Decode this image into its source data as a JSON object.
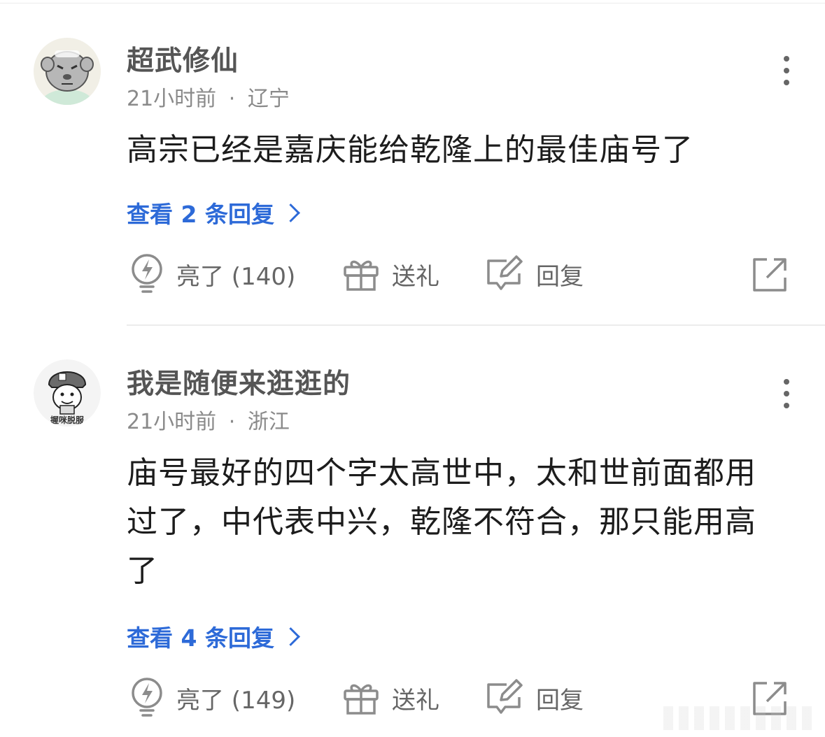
{
  "comments": [
    {
      "username": "超武修仙",
      "time": "21小时前",
      "location": "辽宁",
      "content": "高宗已经是嘉庆能给乾隆上的最佳庙号了",
      "replies_link": "查看 2 条回复",
      "actions": {
        "like_label": "亮了 (140)",
        "gift_label": "送礼",
        "reply_label": "回复"
      }
    },
    {
      "username": "我是随便来逛逛的",
      "time": "21小时前",
      "location": "浙江",
      "content": "庙号最好的四个字太高世中，太和世前面都用过了，中代表中兴，乾隆不符合，那只能用高了",
      "avatar_caption": "握咪脱服",
      "replies_link": "查看 4 条回复",
      "actions": {
        "like_label": "亮了 (149)",
        "gift_label": "送礼",
        "reply_label": "回复"
      }
    }
  ],
  "separator": "·",
  "colors": {
    "link_blue": "#2d6ad8",
    "username_gray": "#555555",
    "meta_gray": "#8a8a8a",
    "action_gray": "#666666",
    "icon_gray": "#8c8c8c"
  },
  "icons": {
    "like": "lightning-bulb-icon",
    "gift": "gift-icon",
    "reply": "edit-reply-icon",
    "share": "share-icon",
    "more": "more-vertical-icon"
  }
}
